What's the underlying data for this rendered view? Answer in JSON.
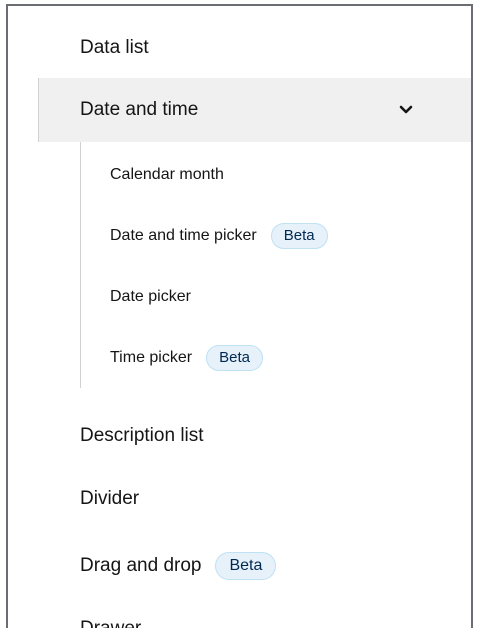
{
  "nav": {
    "data_list": "Data list",
    "date_and_time": {
      "label": "Date and time",
      "expanded": true,
      "children": [
        {
          "label": "Calendar month",
          "badge": ""
        },
        {
          "label": "Date and time picker",
          "badge": "Beta"
        },
        {
          "label": "Date picker",
          "badge": ""
        },
        {
          "label": "Time picker",
          "badge": "Beta"
        }
      ]
    },
    "description_list": "Description list",
    "divider": "Divider",
    "drag_and_drop": {
      "label": "Drag and drop",
      "badge": "Beta"
    },
    "drawer": "Drawer"
  },
  "icons": {
    "chevron": "chevron-down-icon"
  },
  "colors": {
    "active_bg": "#f0f0f0",
    "badge_bg": "#e7f1fa",
    "badge_border": "#bee1f4",
    "badge_text": "#002952",
    "text": "#151515"
  }
}
